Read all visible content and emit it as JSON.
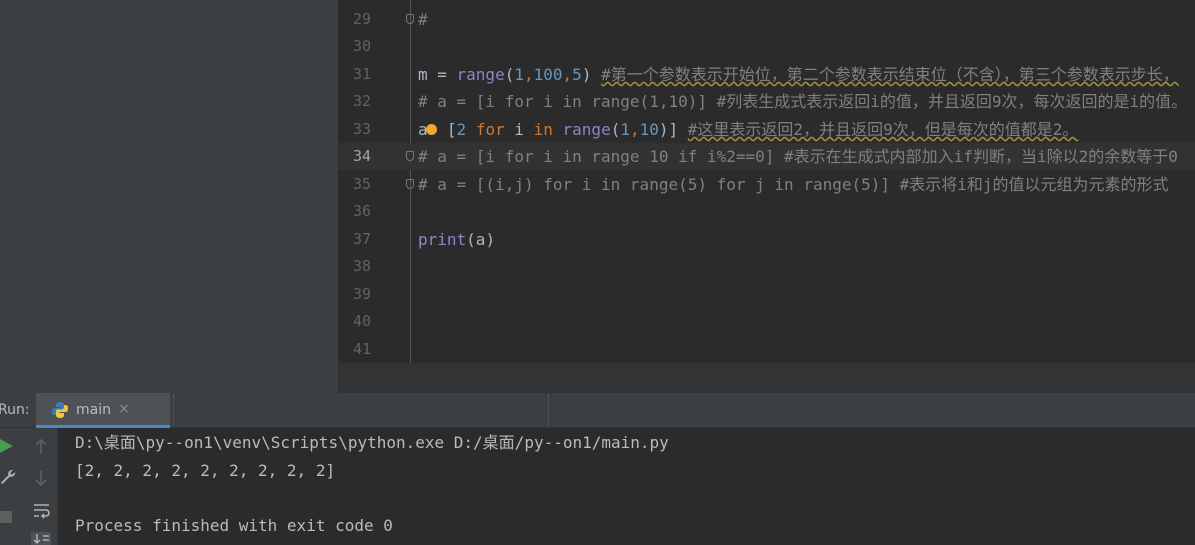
{
  "editor": {
    "lines": [
      {
        "num": "29",
        "current": false
      },
      {
        "num": "30",
        "current": false
      },
      {
        "num": "31",
        "current": false
      },
      {
        "num": "32",
        "current": false
      },
      {
        "num": "33",
        "current": false
      },
      {
        "num": "34",
        "current": true
      },
      {
        "num": "35",
        "current": false
      },
      {
        "num": "36",
        "current": false
      },
      {
        "num": "37",
        "current": false
      },
      {
        "num": "38",
        "current": false
      },
      {
        "num": "39",
        "current": false
      },
      {
        "num": "40",
        "current": false
      },
      {
        "num": "41",
        "current": false
      }
    ],
    "code": {
      "l29": "#",
      "l31_var": "m = ",
      "l31_fn": "range",
      "l31_open": "(",
      "l31_n1": "1",
      "l31_n2": "100",
      "l31_n3": "5",
      "l31_close": ") ",
      "l31_comment": "#第一个参数表示开始位，第二个参数表示结束位（不含），第三个参数表示步长，",
      "l32": "# a = [i for i in range(1,10)] #列表生成式表示返回i的值，并且返回9次，每次返回的是i的值。",
      "l33_var": "a",
      "l33_eq": "= [",
      "l33_n": "2",
      "l33_for": " for ",
      "l33_i": "i ",
      "l33_in": "in ",
      "l33_fn": "range",
      "l33_open": "(",
      "l33_a": "1",
      "l33_b": "10",
      "l33_close": ")] ",
      "l33_comment": "#这里表示返回2，并且返回9次，但是每次的值都是2。",
      "l34": "# a = [i for i in range 10 if i%2==0] #表示在生成式内部加入if判断，当i除以2的余数等于0",
      "l35": "# a = [(i,j) for i in range(5) for j in range(5)] #表示将i和j的值以元组为元素的形式",
      "l37_fn": "print",
      "l37_args": "(a)"
    }
  },
  "run_panel": {
    "label": "Run:",
    "tab_label": "main",
    "tab_close": "×",
    "console": [
      "D:\\桌面\\py--on1\\venv\\Scripts\\python.exe D:/桌面/py--on1/main.py",
      "[2, 2, 2, 2, 2, 2, 2, 2, 2]",
      "",
      "Process finished with exit code 0"
    ]
  },
  "colors": {
    "keyword": "#cc7832",
    "number": "#6897bb",
    "builtin": "#8888c6",
    "comment": "#808080",
    "run_green": "#499c54"
  }
}
